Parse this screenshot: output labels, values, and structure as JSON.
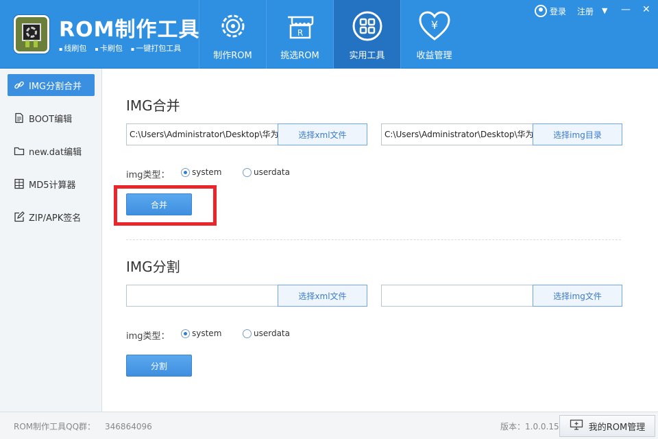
{
  "header": {
    "app_title": "ROM制作工具",
    "subtitles": [
      "线刷包",
      "卡刷包",
      "一键打包工具"
    ],
    "nav": [
      {
        "label": "制作ROM",
        "icon": "gear-icon"
      },
      {
        "label": "挑选ROM",
        "icon": "shop-icon"
      },
      {
        "label": "实用工具",
        "icon": "grid-icon"
      },
      {
        "label": "收益管理",
        "icon": "heart-yen-icon"
      }
    ],
    "active_nav": "实用工具",
    "login": "登录",
    "register": "注册",
    "dropdown_glyph": "▼",
    "minimize_glyph": "—",
    "close_glyph": "✕"
  },
  "sidebar": {
    "items": [
      {
        "label": "IMG分割合并",
        "icon": "link-icon",
        "active": true
      },
      {
        "label": "BOOT编辑",
        "icon": "document-icon"
      },
      {
        "label": "new.dat编辑",
        "icon": "folder-icon"
      },
      {
        "label": "MD5计算器",
        "icon": "calculator-icon"
      },
      {
        "label": "ZIP/APK签名",
        "icon": "edit-icon"
      }
    ]
  },
  "merge": {
    "title": "IMG合并",
    "xml_path": "C:\\Users\\Administrator\\Desktop\\华为",
    "xml_button": "选择xml文件",
    "img_path": "C:\\Users\\Administrator\\Desktop\\华为",
    "img_button": "选择img目录",
    "type_label": "img类型：",
    "options": [
      "system",
      "userdata"
    ],
    "selected": "system",
    "action": "合并"
  },
  "split": {
    "title": "IMG分割",
    "xml_path": "",
    "xml_button": "选择xml文件",
    "img_path": "",
    "img_button": "选择img文件",
    "type_label": "img类型：",
    "options": [
      "system",
      "userdata"
    ],
    "selected": "system",
    "action": "分割"
  },
  "footer": {
    "qq_label": "ROM制作工具QQ群：",
    "qq_number": "346864096",
    "version": "版本：1.0.0.15",
    "rom_manager": "我的ROM管理"
  },
  "colors": {
    "header_bg": "#2f8fe0",
    "active_nav": "#2373c2",
    "highlight": "#e8262c"
  }
}
